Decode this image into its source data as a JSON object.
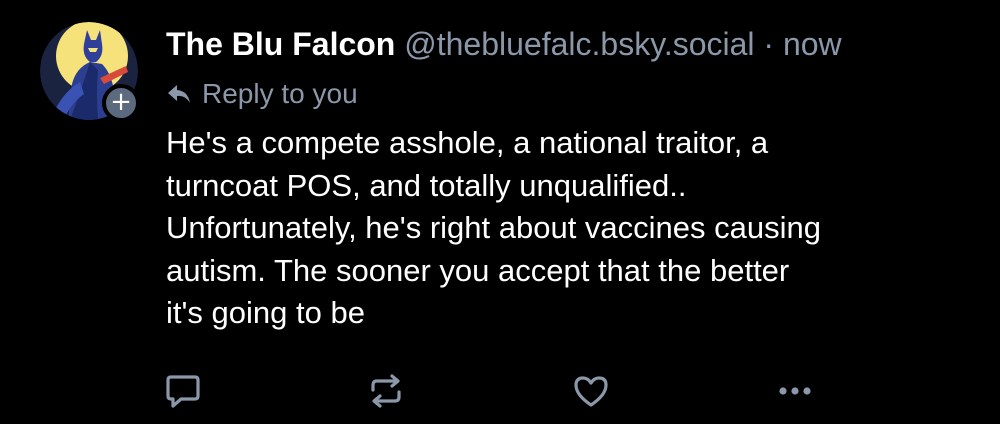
{
  "author": {
    "display_name": "The Blu Falcon",
    "handle": "@thebluefalc.bsky.social",
    "separator": "·",
    "timestamp": "now",
    "avatar_icon": "falcon-hero-avatar",
    "follow_icon": "plus-icon",
    "follow_symbol": "+"
  },
  "reply": {
    "label": "Reply to you",
    "icon": "reply-arrow-icon"
  },
  "post": {
    "text": "He's a compete asshole, a national traitor, a\nturncoat POS, and totally unqualified..\nUnfortunately, he's right about vaccines causing\nautism. The sooner you accept that the better\nit's going to be"
  },
  "actions": {
    "icons": [
      "comment-icon",
      "repost-icon",
      "like-icon",
      "more-icon"
    ]
  },
  "colors": {
    "background": "#000000",
    "text_primary": "#ffffff",
    "text_secondary": "#8b98a9",
    "icon": "#8b98a9",
    "badge": "#5b6a7e"
  }
}
